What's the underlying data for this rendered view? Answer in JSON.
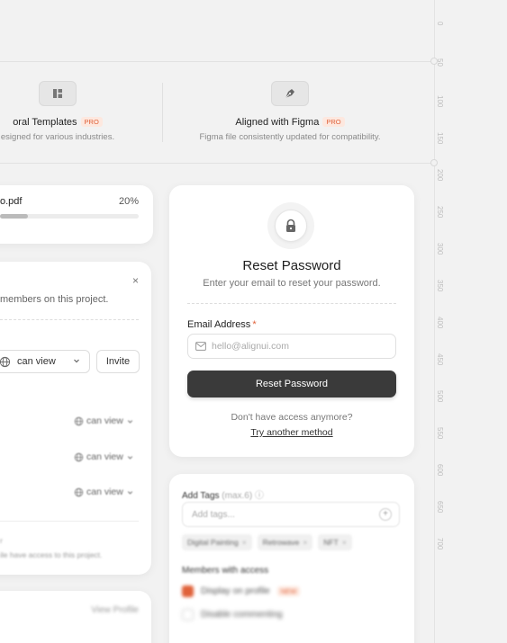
{
  "ruler": {
    "ticks": [
      "0",
      "50",
      "100",
      "150",
      "200",
      "250",
      "300",
      "350",
      "400",
      "450",
      "500",
      "550",
      "600",
      "650",
      "700"
    ]
  },
  "features": [
    {
      "title": "oral Templates",
      "badge": "PRO",
      "desc": "esigned for various industries.",
      "icon": "layout-grid-icon"
    },
    {
      "title": "Aligned with Figma",
      "badge": "PRO",
      "desc": "Figma file consistently updated for compatibility.",
      "icon": "pen-tool-icon"
    }
  ],
  "upload": {
    "file_name": "o.pdf",
    "percent_label": "20%",
    "progress": 0.2
  },
  "share": {
    "close": "×",
    "description": "members on this project.",
    "permission_label": "can view",
    "invite_label": "Invite",
    "rows": [
      "can view",
      "can view",
      "can view"
    ],
    "footer_mark": "r",
    "footer": "ile have access to this project."
  },
  "reset": {
    "title": "Reset Password",
    "subtitle": "Enter your email to reset your password.",
    "email_label": "Email Address",
    "required_mark": "*",
    "email_placeholder": "hello@alignui.com",
    "button_label": "Reset Password",
    "question": "Don't have access anymore?",
    "link": "Try another method"
  },
  "tags": {
    "label": "Add Tags",
    "max": "(max.6)",
    "placeholder": "Add tags...",
    "chips": [
      "Digital Painting",
      "Retrowave",
      "NFT"
    ],
    "members_title": "Members with access",
    "options": [
      {
        "label": "Display on profile",
        "badge": "NEW",
        "checked": true
      },
      {
        "label": "Disable commenting",
        "checked": false
      }
    ]
  },
  "profile": {
    "view_label": "View Profile"
  },
  "colors": {
    "accent": "#e0623a",
    "button": "#3a3a3a"
  }
}
